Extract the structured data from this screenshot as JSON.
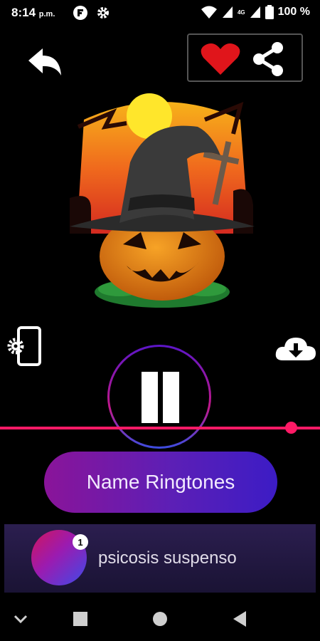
{
  "status_bar": {
    "time": "8:14",
    "ampm": "p.m.",
    "battery_percent": "100 %",
    "network_label": "4G"
  },
  "player": {
    "is_playing": true,
    "progress": 0.91
  },
  "name_ringtones_button": {
    "label": "Name Ringtones"
  },
  "now_playing": {
    "badge": "1",
    "title": "psicosis suspenso"
  },
  "colors": {
    "accent_pink": "#ff1a66",
    "favorite_red": "#e0151b",
    "button_purple_start": "#8a1499",
    "button_purple_end": "#3c1cc5"
  },
  "icons": {
    "back": "back-arrow-icon",
    "favorite": "heart-icon",
    "share": "share-icon",
    "phone_settings": "phone-settings-icon",
    "download": "cloud-download-icon",
    "pause": "pause-icon",
    "nav_down": "chevron-down-icon",
    "nav_recents": "square-icon",
    "nav_home": "circle-icon",
    "nav_back": "triangle-back-icon"
  }
}
